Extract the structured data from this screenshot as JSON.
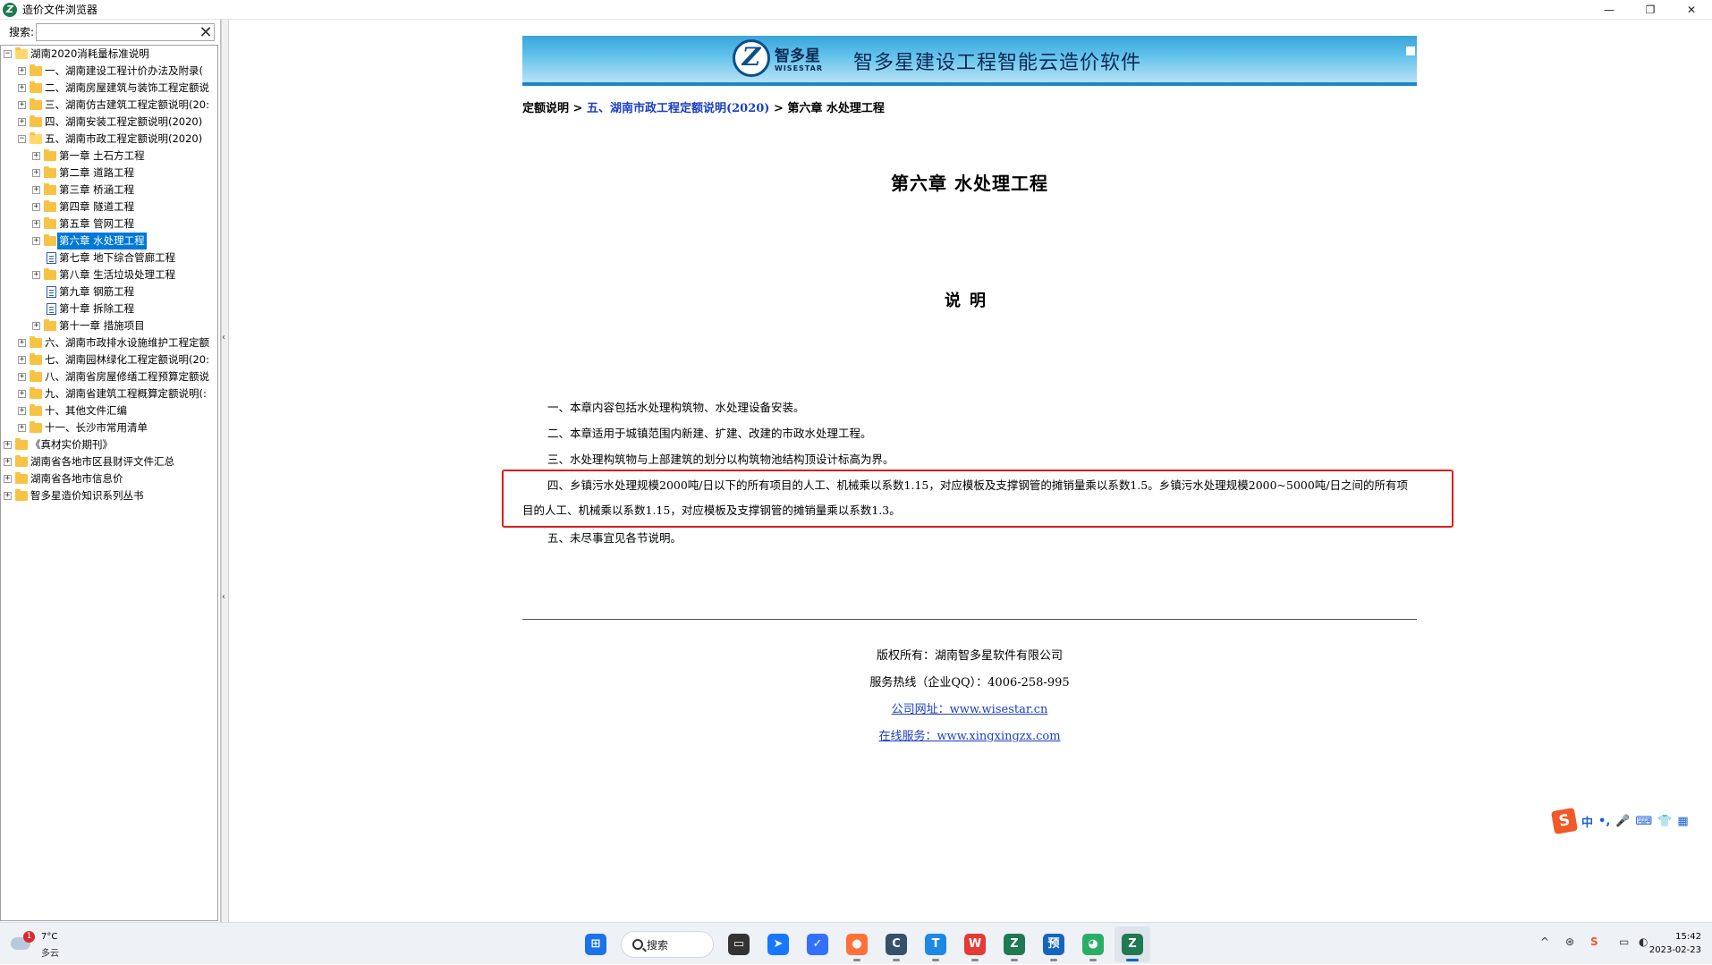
{
  "window": {
    "title": "造价文件浏览器",
    "controls": {
      "minimize": "—",
      "maximize": "❐",
      "close": "✕"
    }
  },
  "left_pane": {
    "search_label": "搜索:",
    "search_value": "",
    "clear_icon": "✕",
    "tree": [
      {
        "label": "湖南2020消耗量标准说明",
        "level": 0,
        "expander": "−",
        "icon": "folder-open"
      },
      {
        "label": "一、湖南建设工程计价办法及附录(",
        "level": 1,
        "expander": "+",
        "icon": "folder"
      },
      {
        "label": "二、湖南房屋建筑与装饰工程定额说",
        "level": 1,
        "expander": "+",
        "icon": "folder"
      },
      {
        "label": "三、湖南仿古建筑工程定额说明(20:",
        "level": 1,
        "expander": "+",
        "icon": "folder"
      },
      {
        "label": "四、湖南安装工程定额说明(2020)",
        "level": 1,
        "expander": "+",
        "icon": "folder"
      },
      {
        "label": "五、湖南市政工程定额说明(2020)",
        "level": 1,
        "expander": "−",
        "icon": "folder-open"
      },
      {
        "label": "第一章  土石方工程",
        "level": 2,
        "expander": "+",
        "icon": "folder"
      },
      {
        "label": "第二章  道路工程",
        "level": 2,
        "expander": "+",
        "icon": "folder"
      },
      {
        "label": "第三章  桥涵工程",
        "level": 2,
        "expander": "+",
        "icon": "folder"
      },
      {
        "label": "第四章  隧道工程",
        "level": 2,
        "expander": "+",
        "icon": "folder"
      },
      {
        "label": "第五章  管网工程",
        "level": 2,
        "expander": "+",
        "icon": "folder"
      },
      {
        "label": "第六章  水处理工程",
        "level": 2,
        "expander": "+",
        "icon": "folder",
        "selected": true
      },
      {
        "label": "第七章  地下综合管廊工程",
        "level": 2,
        "expander": "",
        "icon": "doc"
      },
      {
        "label": "第八章  生活垃圾处理工程",
        "level": 2,
        "expander": "+",
        "icon": "folder"
      },
      {
        "label": "第九章  钢筋工程",
        "level": 2,
        "expander": "",
        "icon": "doc"
      },
      {
        "label": "第十章  拆除工程",
        "level": 2,
        "expander": "",
        "icon": "doc"
      },
      {
        "label": "第十一章  措施项目",
        "level": 2,
        "expander": "+",
        "icon": "folder"
      },
      {
        "label": "六、湖南市政排水设施维护工程定额",
        "level": 1,
        "expander": "+",
        "icon": "folder"
      },
      {
        "label": "七、湖南园林绿化工程定额说明(20:",
        "level": 1,
        "expander": "+",
        "icon": "folder"
      },
      {
        "label": "八、湖南省房屋修缮工程预算定额说",
        "level": 1,
        "expander": "+",
        "icon": "folder"
      },
      {
        "label": "九、湖南省建筑工程概算定额说明(:",
        "level": 1,
        "expander": "+",
        "icon": "folder"
      },
      {
        "label": "十、其他文件汇编",
        "level": 1,
        "expander": "+",
        "icon": "folder"
      },
      {
        "label": "十一、长沙市常用清单",
        "level": 1,
        "expander": "+",
        "icon": "folder"
      },
      {
        "label": "《真材实价期刊》",
        "level": 0,
        "expander": "+",
        "icon": "folder"
      },
      {
        "label": "湖南省各地市区县财评文件汇总",
        "level": 0,
        "expander": "+",
        "icon": "folder"
      },
      {
        "label": "湖南省各地市信息价",
        "level": 0,
        "expander": "+",
        "icon": "folder"
      },
      {
        "label": "智多星造价知识系列丛书",
        "level": 0,
        "expander": "+",
        "icon": "folder"
      }
    ]
  },
  "document": {
    "banner": {
      "logo_letter": "Z",
      "brand_cn": "智多星",
      "brand_en": "WISESTAR",
      "title": "智多星建设工程智能云造价软件"
    },
    "breadcrumb": {
      "root": "定额说明",
      "sep1": " > ",
      "link": "五、湖南市政工程定额说明(2020)",
      "sep2": " > ",
      "current": "第六章 水处理工程"
    },
    "chapter_title": "第六章 水处理工程",
    "section_title": "说明",
    "paragraphs": [
      "一、本章内容包括水处理构筑物、水处理设备安装。",
      "二、本章适用于城镇范围内新建、扩建、改建的市政水处理工程。",
      "三、水处理构筑物与上部建筑的划分以构筑物池结构顶设计标高为界。",
      "四、乡镇污水处理规模2000吨/日以下的所有项目的人工、机械乘以系数1.15，对应模板及支撑钢管的摊销量乘以系数1.5。乡镇污水处理规模2000~5000吨/日之间的所有项目的人工、机械乘以系数1.15，对应模板及支撑钢管的摊销量乘以系数1.3。",
      "五、未尽事宜见各节说明。"
    ],
    "footer": {
      "copyright": "版权所有：湖南智多星软件有限公司",
      "hotline": "服务热线（企业QQ）：4006-258-995",
      "website": "公司网址：www.wisestar.cn",
      "online_service": "在线服务：www.xingxingzx.com"
    }
  },
  "ime_bar": {
    "logo": "S",
    "mode": "中",
    "punct": "•,",
    "mic": "🎤",
    "keyboard": "⌨",
    "skin": "👕",
    "more": "▦"
  },
  "taskbar": {
    "weather": {
      "temp": "7°C",
      "desc": "多云",
      "badge": "1"
    },
    "search_label": "搜索",
    "apps": [
      {
        "name": "start",
        "glyph": "⊞",
        "color": "#1a73e8",
        "active": false,
        "running": false
      },
      {
        "name": "task-view",
        "glyph": "▭",
        "color": "#333333",
        "active": false,
        "running": false
      },
      {
        "name": "app-blue-arrow",
        "glyph": "➤",
        "color": "#1677ff",
        "active": false,
        "running": false
      },
      {
        "name": "app-lark",
        "glyph": "✓",
        "color": "#3370ff",
        "active": false,
        "running": false
      },
      {
        "name": "firefox",
        "glyph": "●",
        "color": "#ff7139",
        "active": false,
        "running": true
      },
      {
        "name": "app-cad",
        "glyph": "C",
        "color": "#35506b",
        "active": false,
        "running": true
      },
      {
        "name": "app-t",
        "glyph": "T",
        "color": "#1e88e5",
        "active": false,
        "running": true
      },
      {
        "name": "wps",
        "glyph": "W",
        "color": "#e53935",
        "active": false,
        "running": true
      },
      {
        "name": "wisestar-app",
        "glyph": "Z",
        "color": "#1f7a52",
        "active": false,
        "running": true
      },
      {
        "name": "app-yu",
        "glyph": "预",
        "color": "#1565c0",
        "active": false,
        "running": true
      },
      {
        "name": "wechat",
        "glyph": "◕",
        "color": "#2aae67",
        "active": false,
        "running": true
      },
      {
        "name": "wisestar-browser",
        "glyph": "Z",
        "color": "#1f7a52",
        "active": true,
        "running": true
      }
    ],
    "tray": {
      "chevron": "^",
      "ime": "S",
      "time": "15:42",
      "date": "2023-02-23"
    }
  }
}
